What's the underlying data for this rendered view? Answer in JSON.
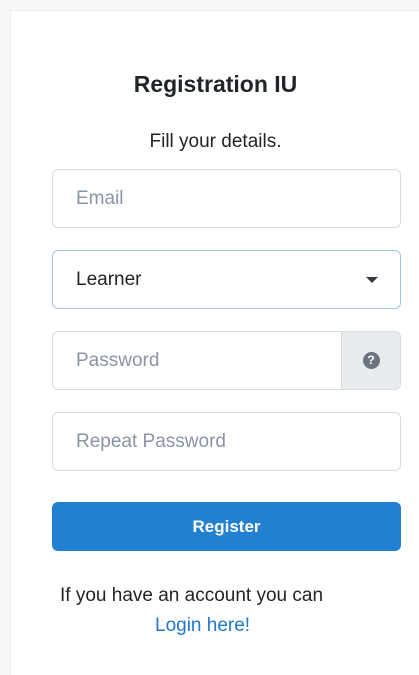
{
  "form": {
    "title": "Registration IU",
    "subtitle": "Fill your details.",
    "email_placeholder": "Email",
    "role_selected": "Learner",
    "password_placeholder": "Password",
    "password_help_icon": "question-circle-icon",
    "repeat_password_placeholder": "Repeat Password",
    "register_label": "Register",
    "account_text": "If you have an account you can",
    "login_link": "Login here!"
  },
  "colors": {
    "primary": "#2280d3",
    "link": "#1e78c9",
    "border": "#d7dbe0",
    "focus_border": "#9cc7e6"
  }
}
